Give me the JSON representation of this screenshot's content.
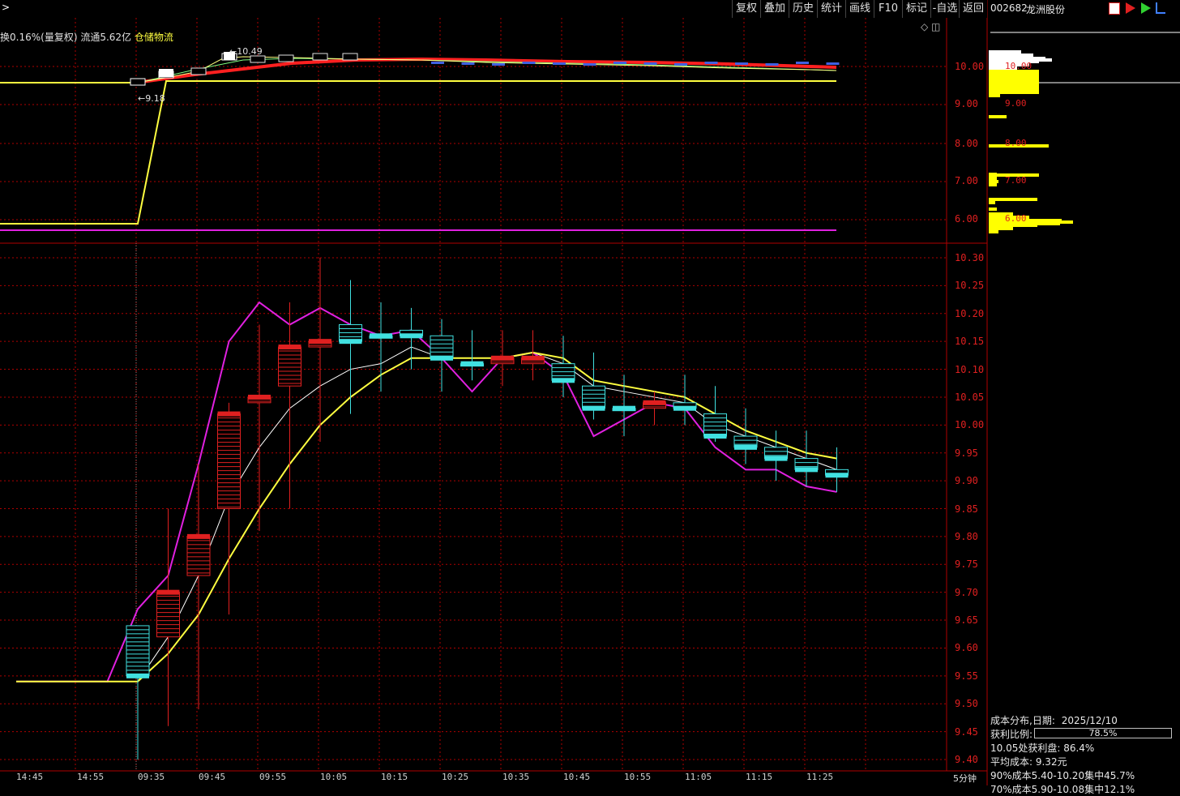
{
  "toolbar": {
    "buttons": [
      "复权",
      "叠加",
      "历史",
      "统计",
      "画线",
      "F10",
      "标记",
      "-自选",
      "返回"
    ]
  },
  "stock": {
    "code": "002682",
    "name": "龙洲股份"
  },
  "info_line": {
    "turnover_pct": "换0.16%(",
    "adjust_text": "量复权)",
    "float_text": "流通5.62亿",
    "sector": "仓储物流"
  },
  "upper_chart": {
    "high_marker": "10.49",
    "low_marker": "9.18",
    "y_ticks": [
      "10.00",
      "9.00",
      "8.00",
      "7.00",
      "6.00"
    ]
  },
  "lower_chart": {
    "y_ticks": [
      "10.30",
      "10.25",
      "10.20",
      "10.15",
      "10.10",
      "10.05",
      "10.00",
      "9.95",
      "9.90",
      "9.85",
      "9.80",
      "9.75",
      "9.70",
      "9.65",
      "9.60",
      "9.55",
      "9.50",
      "9.45",
      "9.40"
    ],
    "x_ticks": [
      "14:45",
      "14:55",
      "09:35",
      "09:45",
      "09:55",
      "10:05",
      "10:15",
      "10:25",
      "10:35",
      "10:45",
      "10:55",
      "11:05",
      "11:15",
      "11:25"
    ],
    "period": "5分钟"
  },
  "chart_data": {
    "type": "candlestick",
    "x": [
      "14:45",
      "14:50",
      "14:55",
      "15:00",
      "09:35",
      "09:40",
      "09:45",
      "09:50",
      "09:55",
      "10:00",
      "10:05",
      "10:10",
      "10:15",
      "10:20",
      "10:25",
      "10:30",
      "10:35",
      "10:40",
      "10:45",
      "10:50",
      "10:55",
      "11:00",
      "11:05",
      "11:10",
      "11:15",
      "11:20",
      "11:25",
      "11:30"
    ],
    "candles": [
      {
        "t": "09:35",
        "o": 9.64,
        "h": 9.64,
        "l": 9.4,
        "c": 9.55,
        "dir": "down"
      },
      {
        "t": "09:40",
        "o": 9.62,
        "h": 9.85,
        "l": 9.46,
        "c": 9.7,
        "dir": "up"
      },
      {
        "t": "09:45",
        "o": 9.73,
        "h": 9.93,
        "l": 9.49,
        "c": 9.8,
        "dir": "up"
      },
      {
        "t": "09:50",
        "o": 9.85,
        "h": 10.04,
        "l": 9.66,
        "c": 10.02,
        "dir": "up"
      },
      {
        "t": "09:55",
        "o": 10.04,
        "h": 10.18,
        "l": 9.81,
        "c": 10.05,
        "dir": "up"
      },
      {
        "t": "10:00",
        "o": 10.07,
        "h": 10.22,
        "l": 9.85,
        "c": 10.14,
        "dir": "up"
      },
      {
        "t": "10:05",
        "o": 10.14,
        "h": 10.3,
        "l": 9.97,
        "c": 10.15,
        "dir": "up"
      },
      {
        "t": "10:10",
        "o": 10.18,
        "h": 10.26,
        "l": 10.02,
        "c": 10.15,
        "dir": "down"
      },
      {
        "t": "10:15",
        "o": 10.16,
        "h": 10.22,
        "l": 10.06,
        "c": 10.16,
        "dir": "down"
      },
      {
        "t": "10:20",
        "o": 10.17,
        "h": 10.21,
        "l": 10.1,
        "c": 10.16,
        "dir": "down"
      },
      {
        "t": "10:25",
        "o": 10.16,
        "h": 10.19,
        "l": 10.06,
        "c": 10.12,
        "dir": "down"
      },
      {
        "t": "10:30",
        "o": 10.11,
        "h": 10.17,
        "l": 10.08,
        "c": 10.11,
        "dir": "down"
      },
      {
        "t": "10:35",
        "o": 10.11,
        "h": 10.17,
        "l": 10.07,
        "c": 10.12,
        "dir": "up"
      },
      {
        "t": "10:40",
        "o": 10.11,
        "h": 10.17,
        "l": 10.08,
        "c": 10.12,
        "dir": "up"
      },
      {
        "t": "10:45",
        "o": 10.11,
        "h": 10.16,
        "l": 10.05,
        "c": 10.08,
        "dir": "down"
      },
      {
        "t": "10:50",
        "o": 10.07,
        "h": 10.13,
        "l": 10.01,
        "c": 10.03,
        "dir": "down"
      },
      {
        "t": "10:55",
        "o": 10.03,
        "h": 10.09,
        "l": 9.98,
        "c": 10.03,
        "dir": "down"
      },
      {
        "t": "11:00",
        "o": 10.03,
        "h": 10.06,
        "l": 10.0,
        "c": 10.04,
        "dir": "up"
      },
      {
        "t": "11:05",
        "o": 10.04,
        "h": 10.09,
        "l": 10.0,
        "c": 10.03,
        "dir": "down"
      },
      {
        "t": "11:10",
        "o": 10.02,
        "h": 10.07,
        "l": 9.97,
        "c": 9.98,
        "dir": "down"
      },
      {
        "t": "11:15",
        "o": 9.98,
        "h": 10.03,
        "l": 9.93,
        "c": 9.96,
        "dir": "down"
      },
      {
        "t": "11:20",
        "o": 9.96,
        "h": 9.99,
        "l": 9.9,
        "c": 9.94,
        "dir": "down"
      },
      {
        "t": "11:25",
        "o": 9.94,
        "h": 9.99,
        "l": 9.89,
        "c": 9.92,
        "dir": "down"
      },
      {
        "t": "11:30",
        "o": 9.92,
        "h": 9.96,
        "l": 9.88,
        "c": 9.91,
        "dir": "down"
      }
    ],
    "series": [
      {
        "name": "lower",
        "color": "#e020e0",
        "values": [
          9.54,
          9.54,
          9.54,
          9.54,
          9.67,
          9.73,
          9.93,
          10.15,
          10.22,
          10.18,
          10.21,
          10.18,
          10.16,
          10.17,
          10.12,
          10.06,
          10.12,
          10.13,
          10.09,
          9.98,
          10.01,
          10.04,
          10.03,
          9.96,
          9.92,
          9.92,
          9.89,
          9.88
        ]
      },
      {
        "name": "mid",
        "color": "#ffffff",
        "values": [
          null,
          null,
          null,
          null,
          9.54,
          9.62,
          9.73,
          9.87,
          9.96,
          10.03,
          10.07,
          10.1,
          10.11,
          10.14,
          10.12,
          10.12,
          10.12,
          10.13,
          10.11,
          10.07,
          10.06,
          10.05,
          10.04,
          10.0,
          9.98,
          9.96,
          9.94,
          9.92
        ]
      },
      {
        "name": "upper",
        "color": "#ffff40",
        "values": [
          9.54,
          9.54,
          9.54,
          9.54,
          9.54,
          9.59,
          9.66,
          9.76,
          9.85,
          9.93,
          10.0,
          10.05,
          10.09,
          10.12,
          10.12,
          10.12,
          10.12,
          10.13,
          10.12,
          10.08,
          10.07,
          10.06,
          10.05,
          10.02,
          9.99,
          9.97,
          9.95,
          9.94
        ]
      }
    ],
    "ylim": [
      9.38,
      10.32
    ]
  },
  "cost_panel": {
    "title": "成本分布,日期:",
    "date": "2025/12/10",
    "profit_ratio_label": "获利比例:",
    "profit_ratio": "78.5%",
    "profit_ratio_value": 0.785,
    "line1": "10.05处获利盘: 86.4%",
    "line2": "平均成本: 9.32元",
    "line3": "90%成本5.40-10.20集中45.7%",
    "line4": "70%成本5.90-10.08集中12.1%",
    "y_ticks": [
      "10.00",
      "9.00",
      "8.00",
      "7.00",
      "6.00"
    ]
  },
  "colors": {
    "up": "#e02020",
    "down": "#40e0e0",
    "grid": "#b00000",
    "profit": "#ffff00"
  }
}
